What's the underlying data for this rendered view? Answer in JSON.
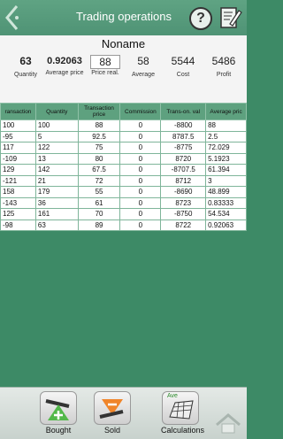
{
  "header": {
    "title": "Trading operations",
    "help_label": "?"
  },
  "instrument": {
    "name": "Noname",
    "stats": [
      {
        "value": "63",
        "label": "Quantity"
      },
      {
        "value": "0.92063",
        "label": "Average price"
      },
      {
        "value": "88",
        "label": "Price real."
      },
      {
        "value": "58",
        "label": "Average"
      },
      {
        "value": "5544",
        "label": "Cost"
      },
      {
        "value": "5486",
        "label": "Profit"
      }
    ]
  },
  "table": {
    "columns": [
      "ransaction",
      "Quantity",
      "Transaction price",
      "Commission",
      "Trans-on. val",
      "Average pric"
    ],
    "rows": [
      [
        "100",
        "100",
        "88",
        "0",
        "-8800",
        "88"
      ],
      [
        "-95",
        "5",
        "92.5",
        "0",
        "8787.5",
        "2.5"
      ],
      [
        "117",
        "122",
        "75",
        "0",
        "-8775",
        "72.029"
      ],
      [
        "-109",
        "13",
        "80",
        "0",
        "8720",
        "5.1923"
      ],
      [
        "129",
        "142",
        "67.5",
        "0",
        "-8707.5",
        "61.394"
      ],
      [
        "-121",
        "21",
        "72",
        "0",
        "8712",
        "3"
      ],
      [
        "158",
        "179",
        "55",
        "0",
        "-8690",
        "48.899"
      ],
      [
        "-143",
        "36",
        "61",
        "0",
        "8723",
        "0.83333"
      ],
      [
        "125",
        "161",
        "70",
        "0",
        "-8750",
        "54.534"
      ],
      [
        "-98",
        "63",
        "89",
        "0",
        "8722",
        "0.92063"
      ]
    ]
  },
  "bottom": {
    "bought_label": "Bought",
    "sold_label": "Sold",
    "calc_label": "Calculations",
    "calc_icon_text": "Ave"
  }
}
